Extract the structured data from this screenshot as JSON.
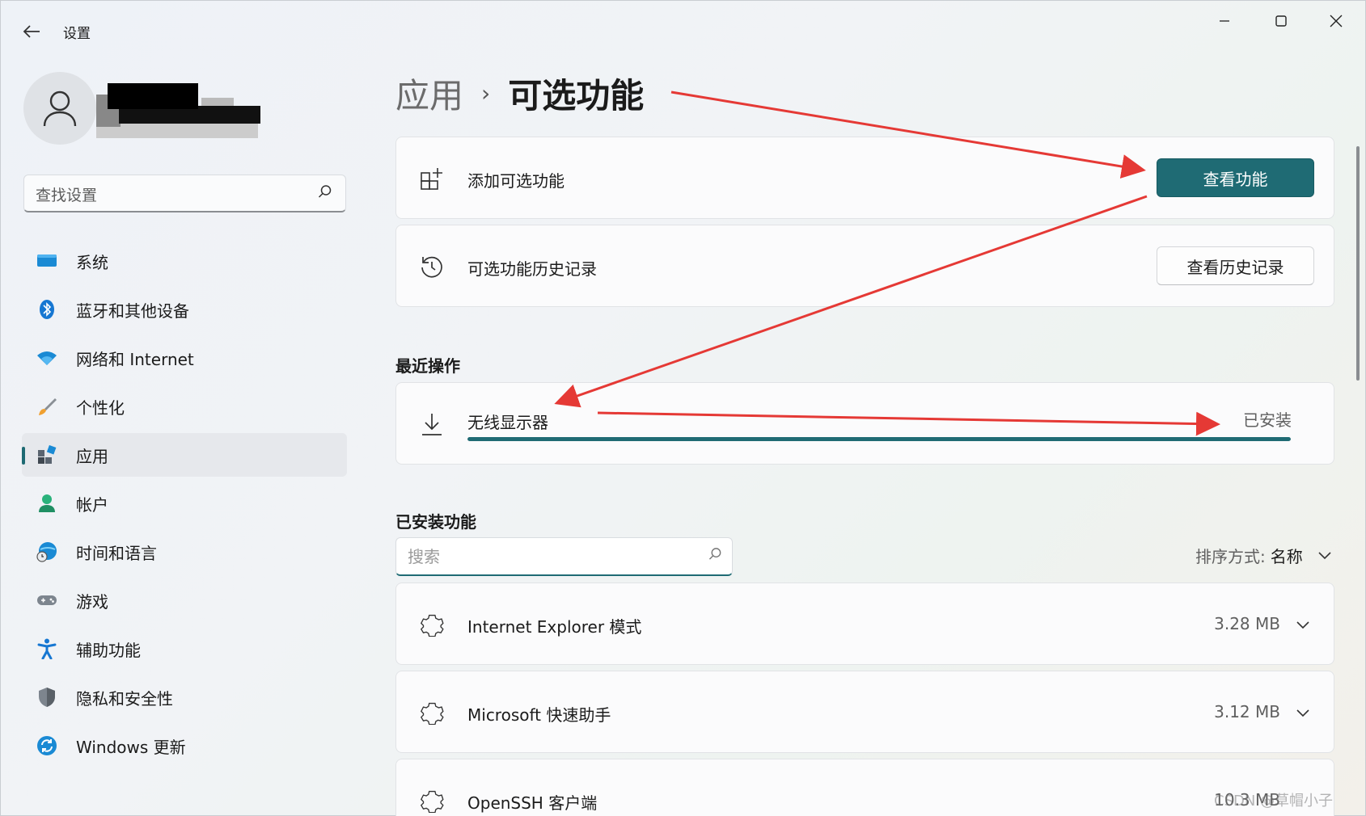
{
  "window": {
    "title": "设置",
    "controls": {
      "minimize": "—",
      "maximize": "☐",
      "close": "✕"
    }
  },
  "search": {
    "placeholder": "查找设置"
  },
  "nav": {
    "items": [
      {
        "label": "系统",
        "icon": "monitor-icon"
      },
      {
        "label": "蓝牙和其他设备",
        "icon": "bluetooth-icon"
      },
      {
        "label": "网络和 Internet",
        "icon": "wifi-icon"
      },
      {
        "label": "个性化",
        "icon": "brush-icon"
      },
      {
        "label": "应用",
        "icon": "apps-icon",
        "active": true
      },
      {
        "label": "帐户",
        "icon": "account-icon"
      },
      {
        "label": "时间和语言",
        "icon": "globe-clock-icon"
      },
      {
        "label": "游戏",
        "icon": "gamepad-icon"
      },
      {
        "label": "辅助功能",
        "icon": "accessibility-icon"
      },
      {
        "label": "隐私和安全性",
        "icon": "shield-icon"
      },
      {
        "label": "Windows 更新",
        "icon": "update-icon"
      }
    ]
  },
  "breadcrumb": {
    "parent": "应用",
    "separator": "›",
    "current": "可选功能"
  },
  "add_feature": {
    "label": "添加可选功能",
    "button": "查看功能"
  },
  "history": {
    "label": "可选功能历史记录",
    "button": "查看历史记录"
  },
  "recent": {
    "title": "最近操作",
    "item": {
      "name": "无线显示器",
      "status": "已安装",
      "progress": 1.0
    }
  },
  "installed": {
    "title": "已安装功能",
    "search_placeholder": "搜索",
    "sort_label": "排序方式:",
    "sort_value": "名称",
    "items": [
      {
        "name": "Internet Explorer 模式",
        "size": "3.28 MB"
      },
      {
        "name": "Microsoft 快速助手",
        "size": "3.12 MB"
      },
      {
        "name": "OpenSSH 客户端",
        "size": "10.3 MB"
      }
    ]
  },
  "watermark": "CSDN @草帽小子",
  "colors": {
    "accent": "#1f6b74",
    "annotation": "#e53935"
  }
}
